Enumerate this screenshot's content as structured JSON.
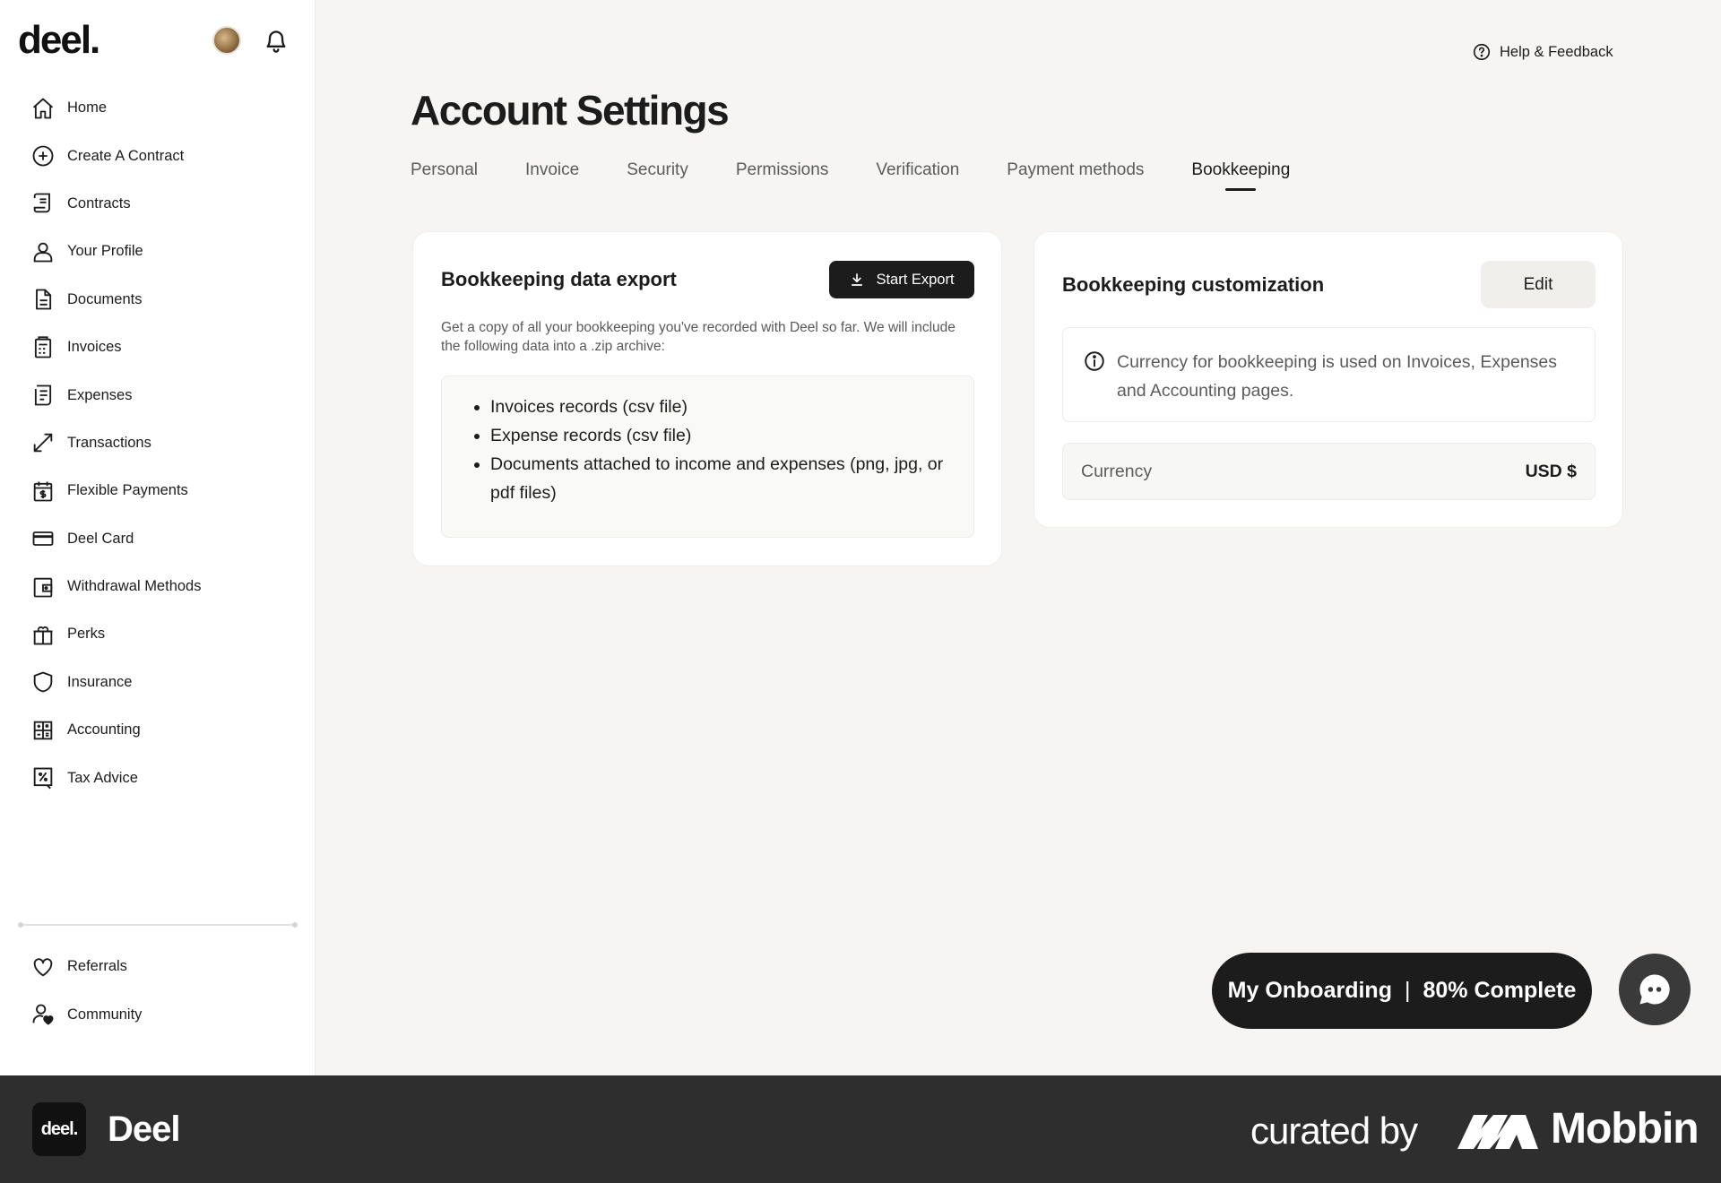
{
  "sidebar": {
    "logo": "deel.",
    "items": [
      {
        "label": "Home",
        "icon": "home-icon"
      },
      {
        "label": "Create A Contract",
        "icon": "plus-circle-icon"
      },
      {
        "label": "Contracts",
        "icon": "contract-icon"
      },
      {
        "label": "Your Profile",
        "icon": "user-icon"
      },
      {
        "label": "Documents",
        "icon": "document-icon"
      },
      {
        "label": "Invoices",
        "icon": "invoice-icon"
      },
      {
        "label": "Expenses",
        "icon": "receipt-icon"
      },
      {
        "label": "Transactions",
        "icon": "transfer-arrows-icon"
      },
      {
        "label": "Flexible Payments",
        "icon": "calendar-dollar-icon"
      },
      {
        "label": "Deel Card",
        "icon": "credit-card-icon"
      },
      {
        "label": "Withdrawal Methods",
        "icon": "wallet-icon"
      },
      {
        "label": "Perks",
        "icon": "gift-icon"
      },
      {
        "label": "Insurance",
        "icon": "shield-icon"
      },
      {
        "label": "Accounting",
        "icon": "calculator-icon"
      },
      {
        "label": "Tax Advice",
        "icon": "tax-percent-icon"
      }
    ],
    "bottom_items": [
      {
        "label": "Referrals",
        "icon": "heart-icon"
      },
      {
        "label": "Community",
        "icon": "community-icon"
      }
    ]
  },
  "header": {
    "help_label": "Help & Feedback",
    "page_title": "Account Settings"
  },
  "tabs": [
    {
      "label": "Personal",
      "active": false
    },
    {
      "label": "Invoice",
      "active": false
    },
    {
      "label": "Security",
      "active": false
    },
    {
      "label": "Permissions",
      "active": false
    },
    {
      "label": "Verification",
      "active": false
    },
    {
      "label": "Payment methods",
      "active": false
    },
    {
      "label": "Bookkeeping",
      "active": true
    }
  ],
  "export_card": {
    "title": "Bookkeeping data export",
    "button_label": "Start Export",
    "description": "Get a copy of all your bookkeeping you've recorded with Deel so far. We will include the following data into a .zip archive:",
    "items": [
      "Invoices records (csv file)",
      "Expense records (csv file)",
      "Documents attached to income and expenses (png, jpg, or pdf files)"
    ]
  },
  "customization_card": {
    "title": "Bookkeeping customization",
    "edit_label": "Edit",
    "info_text": "Currency for bookkeeping is used on Invoices, Expenses and Accounting pages.",
    "currency_label": "Currency",
    "currency_value": "USD $"
  },
  "onboarding": {
    "label": "My Onboarding",
    "separator": "|",
    "progress_text": "80% Complete",
    "progress": 0.8
  },
  "footer": {
    "logo_text": "deel.",
    "app_name": "Deel",
    "curated_by": "curated by",
    "brand": "Mobbin"
  },
  "colors": {
    "primary_dark": "#1c1c1c",
    "background": "#f6f5f3",
    "footer_bg": "#2e2e2e"
  }
}
